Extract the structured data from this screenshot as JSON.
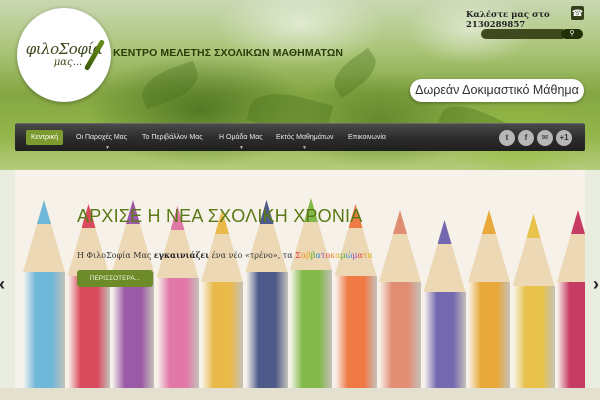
{
  "header": {
    "logo": {
      "line1": "φιλοΣοφία",
      "line2": "μας..."
    },
    "tagline": "ΚΕΝΤΡΟ ΜΕΛΕΤΗΣ ΣΧΟΛΙΚΩΝ ΜΑΘΗΜΑΤΩΝ",
    "call_label": "Καλέστε μας στο 2130289857",
    "search": {
      "placeholder": "",
      "button": ""
    },
    "trial_button": "Δωρεάν Δοκιμαστικό Μάθημα"
  },
  "nav": {
    "items": [
      {
        "label": "Κεντρική",
        "active": true,
        "has_children": false
      },
      {
        "label": "Οι Παροχές Μας",
        "active": false,
        "has_children": true
      },
      {
        "label": "Το Περιβάλλον Μας",
        "active": false,
        "has_children": false
      },
      {
        "label": "Η Ομάδα Μας",
        "active": false,
        "has_children": true
      },
      {
        "label": "Εκτός Μαθημάτων",
        "active": false,
        "has_children": true
      },
      {
        "label": "Επικοινωνία",
        "active": false,
        "has_children": false
      }
    ],
    "social": [
      {
        "icon": "twitter-icon",
        "glyph": "t"
      },
      {
        "icon": "facebook-icon",
        "glyph": "f"
      },
      {
        "icon": "email-icon",
        "glyph": "✉"
      },
      {
        "icon": "google-plus-icon",
        "glyph": "+1"
      }
    ]
  },
  "slide": {
    "title": "ΑΡΧΙΣΕ Η ΝΕΑ ΣΧΟΛΙΚΗ ΧΡΟΝΙΑ",
    "desc_pre": "Η ΦιλοΣοφία Μας ",
    "desc_bold": "εγκαινιάζει",
    "desc_mid": " ένα νέο «τρένο», τα ",
    "desc_rainbow": "Σαββατοκαμώματα",
    "more_button": "ΠΕΡΙΣΣΟΤΕΡΑ..."
  },
  "colors": {
    "accent": "#7d9a2e",
    "pencils": [
      "#6fb7d8",
      "#d94a5c",
      "#9b5aa5",
      "#e278a8",
      "#e9b94a",
      "#4d5a8a",
      "#83b84a",
      "#ef7a46",
      "#e08f74",
      "#7468b0",
      "#e8a83a",
      "#e8c24a",
      "#c73c62"
    ]
  }
}
